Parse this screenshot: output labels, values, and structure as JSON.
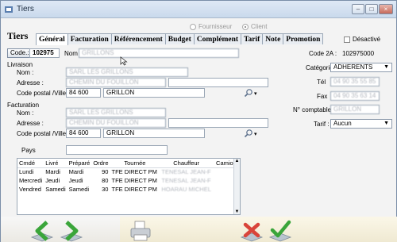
{
  "window": {
    "title": "Tiers"
  },
  "type_radio": {
    "fournisseur": "Fournisseur",
    "client": "Client"
  },
  "header": {
    "label": "Tiers"
  },
  "tabs": [
    "Général",
    "Facturation",
    "Référencement",
    "Budget",
    "Complément",
    "Tarif",
    "Note",
    "Promotion"
  ],
  "desactive": {
    "label": "Désactivé"
  },
  "code": {
    "button_label": "Code",
    "value": "102975",
    "nom_label": "Nom",
    "nom_value": "GRILLONS"
  },
  "code2a": {
    "label": "Code 2A :",
    "value": "102975000"
  },
  "livraison": {
    "section": "Livraison",
    "nom_label": "Nom :",
    "nom_value": "SARL LES GRILLONS",
    "adresse_label": "Adresse :",
    "adresse_value": "CHEMIN DU FOUILLON",
    "adresse2_value": "",
    "cp_label": "Code postal /Ville",
    "cp_value": "84 600",
    "ville_value": "GRILLON"
  },
  "facturation": {
    "section": "Facturation",
    "nom_label": "Nom :",
    "nom_value": "SARL LES GRILLONS",
    "adresse_label": "Adresse :",
    "adresse_value": "CHEMIN DU FOUILLON",
    "adresse2_value": "",
    "cp_label": "Code postal /Ville",
    "cp_value": "84 600",
    "ville_value": "GRILLON"
  },
  "pays": {
    "label": "Pays",
    "value": ""
  },
  "right": {
    "categorie_label": "Catégorie",
    "categorie_value": "ADHERENTS",
    "tel_label": "Tél",
    "tel_value": "04 90 35 55 85",
    "fax_label": "Fax",
    "fax_value": "04 90 35 63 14",
    "ncompt_label": "N° comptable :",
    "ncompt_value": "GRILLON",
    "tarif_label": "Tarif :",
    "tarif_value": "Aucun"
  },
  "grid": {
    "columns": [
      "Cmdé",
      "Livré",
      "Préparé",
      "Ordre",
      "Tournée",
      "Chauffeur",
      "Camion"
    ],
    "rows": [
      {
        "cmde": "Lundi",
        "livre": "Mardi",
        "prepare": "Mardi",
        "ordre": "90",
        "tournee": "TFE DIRECT PM",
        "chauffeur": "TENESAL JEAN-F",
        "camion": ""
      },
      {
        "cmde": "Mercredi",
        "livre": "Jeudi",
        "prepare": "Jeudi",
        "ordre": "80",
        "tournee": "TFE DIRECT PM",
        "chauffeur": "TENESAL JEAN-F",
        "camion": ""
      },
      {
        "cmde": "Vendred",
        "livre": "Samedi",
        "prepare": "Samedi",
        "ordre": "30",
        "tournee": "TFE DIRECT PM",
        "chauffeur": "HOARAU MICHEL",
        "camion": ""
      }
    ]
  },
  "colors": {
    "accent_green": "#3aa53a",
    "cancel_red": "#d9443a",
    "title_gradient": "#c9d9ec"
  }
}
